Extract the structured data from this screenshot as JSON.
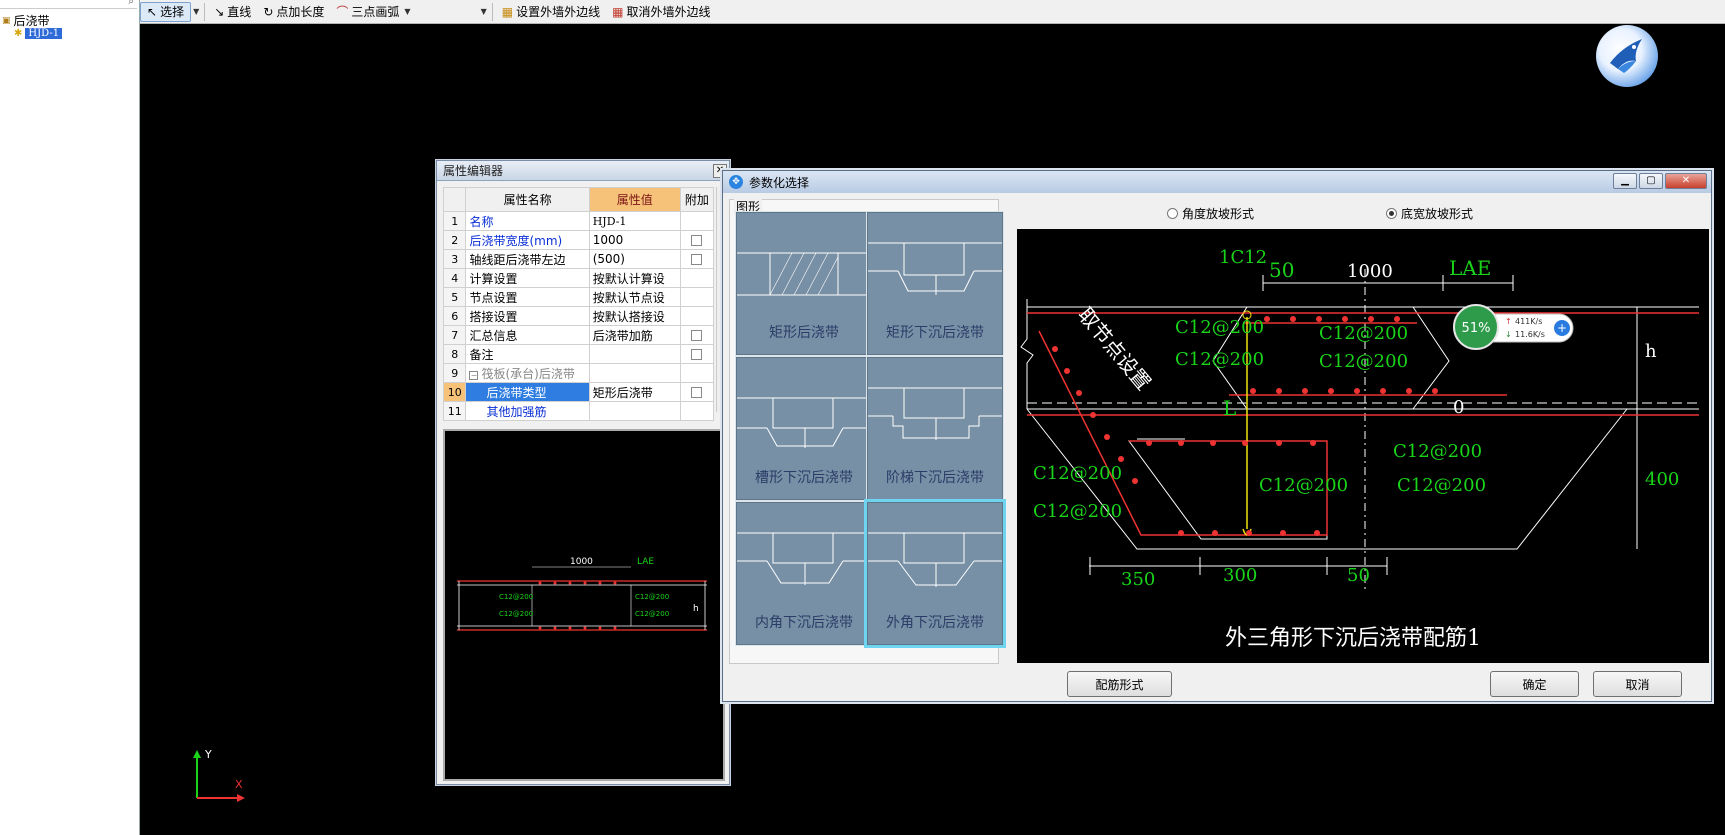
{
  "tree": {
    "root_label": "后浇带",
    "child_label": "HJD-1"
  },
  "toolbar": {
    "select": "选择",
    "line": "直线",
    "point_length": "点加长度",
    "arc": "三点画弧",
    "set_outer": "设置外墙外边线",
    "cancel_outer": "取消外墙外边线"
  },
  "prop_editor": {
    "title": "属性编辑器",
    "headers": {
      "name": "属性名称",
      "value": "属性值",
      "extra": "附加"
    },
    "rows": [
      {
        "num": "1",
        "name": "名称",
        "value": "HJD-1"
      },
      {
        "num": "2",
        "name": "后浇带宽度(mm)",
        "value": "1000"
      },
      {
        "num": "3",
        "name": "轴线距后浇带左边",
        "value": "(500)"
      },
      {
        "num": "4",
        "name": "计算设置",
        "value": "按默认计算设"
      },
      {
        "num": "5",
        "name": "节点设置",
        "value": "按默认节点设"
      },
      {
        "num": "6",
        "name": "搭接设置",
        "value": "按默认搭接设"
      },
      {
        "num": "7",
        "name": "汇总信息",
        "value": "后浇带加筋"
      },
      {
        "num": "8",
        "name": "备注",
        "value": ""
      },
      {
        "num": "9",
        "name": "筏板(承台)后浇带",
        "value": ""
      },
      {
        "num": "10",
        "name": "后浇带类型",
        "value": "矩形后浇带"
      },
      {
        "num": "11",
        "name": "其他加强筋",
        "value": ""
      }
    ],
    "preview": {
      "dim_width": "1000",
      "dim_lae": "LAE",
      "rebar": "C12@200",
      "h": "h"
    }
  },
  "dialog": {
    "title": "参数化选择",
    "shapes_label": "图形",
    "shapes": [
      "矩形后浇带",
      "矩形下沉后浇带",
      "槽形下沉后浇带",
      "阶梯下沉后浇带",
      "内角下沉后浇带",
      "外角下沉后浇带"
    ],
    "radio_angle": "角度放坡形式",
    "radio_width": "底宽放坡形式",
    "btn_rebar": "配筋形式",
    "btn_ok": "确定",
    "btn_cancel": "取消",
    "drawing": {
      "caption": "外三角形下沉后浇带配筋1",
      "top_bar": "1C12",
      "dim_50a": "50",
      "dim_1000": "1000",
      "lae": "LAE",
      "rebar": "C12@200",
      "node_label": "取节点设置",
      "h": "h",
      "L": "L",
      "zero": "0",
      "dim_400": "400",
      "dim_350": "350",
      "dim_300": "300",
      "dim_50b": "50"
    }
  },
  "net_monitor": {
    "percent": "51%",
    "up": "411K/s",
    "down": "11.6K/s"
  },
  "axes": {
    "y": "Y",
    "x": "X"
  }
}
